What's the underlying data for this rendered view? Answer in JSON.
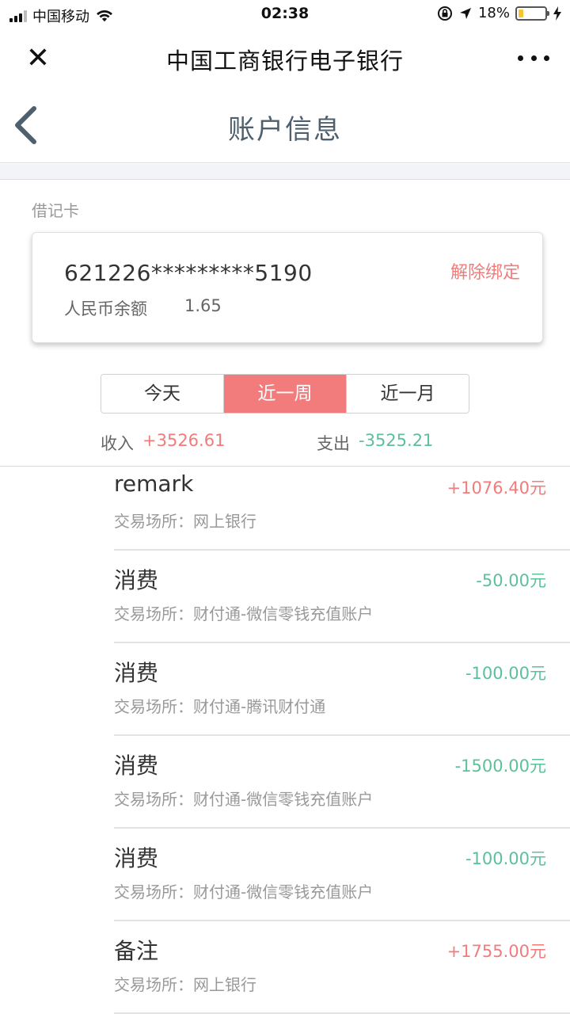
{
  "status_bar": {
    "carrier": "中国移动",
    "time": "02:38",
    "battery_percent_text": "18%",
    "battery_level": 0.18,
    "battery_color": "#f6c630"
  },
  "browser_header": {
    "title": "中国工商银行电子银行",
    "close_icon": "close-icon",
    "more_icon": "more-dots-icon"
  },
  "nav": {
    "title": "账户信息",
    "back_icon": "chevron-left-icon"
  },
  "card": {
    "section_label": "借记卡",
    "number": "621226*********5190",
    "unbind_label": "解除绑定",
    "balance_label": "人民币余额",
    "balance_value": "1.65"
  },
  "period_tabs": [
    {
      "label": "今天",
      "active": false
    },
    {
      "label": "近一周",
      "active": true
    },
    {
      "label": "近一月",
      "active": false
    }
  ],
  "summary": {
    "income_label": "收入",
    "income_value": "+3526.61",
    "expense_label": "支出",
    "expense_value": "-3525.21"
  },
  "transactions": [
    {
      "title": "remark",
      "place": "交易场所：网上银行",
      "amount": "+1076.40元",
      "type": "income"
    },
    {
      "title": "消费",
      "place": "交易场所：财付通-微信零钱充值账户",
      "amount": "-50.00元",
      "type": "expense"
    },
    {
      "title": "消费",
      "place": "交易场所：财付通-腾讯财付通",
      "amount": "-100.00元",
      "type": "expense"
    },
    {
      "title": "消费",
      "place": "交易场所：财付通-微信零钱充值账户",
      "amount": "-1500.00元",
      "type": "expense"
    },
    {
      "title": "消费",
      "place": "交易场所：财付通-微信零钱充值账户",
      "amount": "-100.00元",
      "type": "expense"
    },
    {
      "title": "备注",
      "place": "交易场所：网上银行",
      "amount": "+1755.00元",
      "type": "income"
    }
  ],
  "colors": {
    "accent": "#f27b7b",
    "income": "#f27b7b",
    "expense": "#5cc09b",
    "nav_title": "#4e5f6e"
  }
}
